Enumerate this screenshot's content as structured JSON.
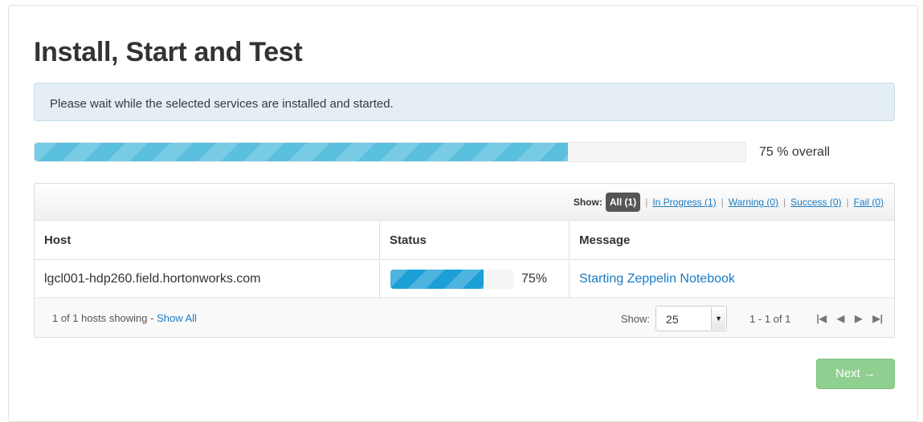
{
  "page": {
    "title": "Install, Start and Test"
  },
  "alert": {
    "text": "Please wait while the selected services are installed and started."
  },
  "overall": {
    "progress": 0.75,
    "label": "75 % overall"
  },
  "filter": {
    "show_label": "Show:",
    "active": "All (1)",
    "links": [
      "In Progress (1)",
      "Warning (0)",
      "Success (0)",
      "Fail (0)"
    ]
  },
  "table": {
    "headers": [
      "Host",
      "Status",
      "Message"
    ],
    "rows": [
      {
        "host": "lgcl001-hdp260.field.hortonworks.com",
        "progress": 0.75,
        "percent": "75%",
        "message": "Starting Zeppelin Notebook"
      }
    ]
  },
  "footer": {
    "showing": "1 of 1 hosts showing - ",
    "show_all": "Show All",
    "show_label": "Show:",
    "page_size": "25",
    "range": "1 - 1 of 1"
  },
  "colors": {
    "overall_bar": "#5bc0de",
    "row_bar": "#1b9fd6",
    "next_button": "#8fcf8f",
    "link": "#1a7bc4"
  },
  "icons": [
    "first-page-icon",
    "prev-page-icon",
    "next-page-icon",
    "last-page-icon"
  ],
  "next_button": {
    "label": "Next →"
  }
}
